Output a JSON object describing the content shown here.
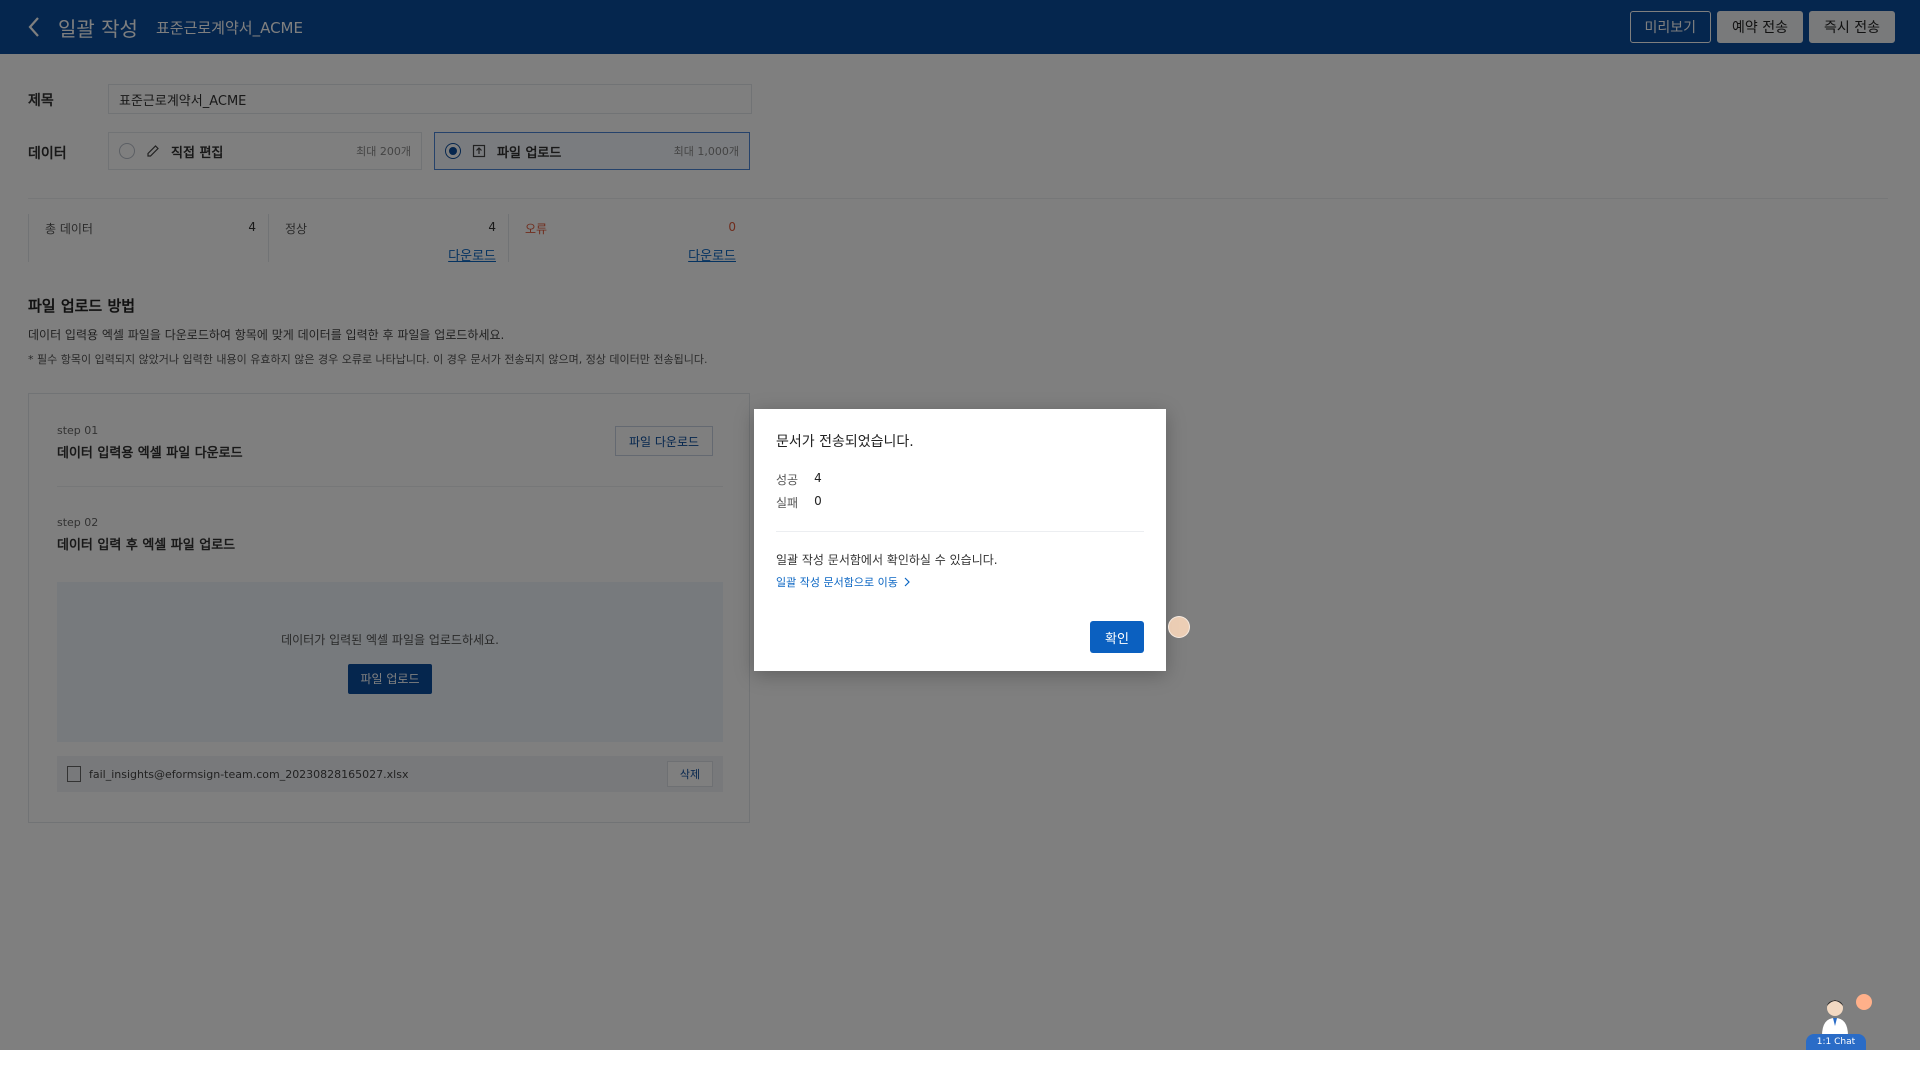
{
  "header": {
    "back_icon": "chevron-left-icon",
    "title": "일괄 작성",
    "doc_name": "표준근로계약서_ACME",
    "preview_label": "미리보기",
    "schedule_label": "예약 전송",
    "send_now_label": "즉시 전송"
  },
  "form": {
    "title_label": "제목",
    "title_value": "표준근로계약서_ACME",
    "data_label": "데이터",
    "option_direct": {
      "label": "직접 편집",
      "max": "최대 200개",
      "icon": "pencil-icon"
    },
    "option_upload": {
      "label": "파일 업로드",
      "max": "최대 1,000개",
      "icon": "upload-icon"
    }
  },
  "stats": {
    "total_label": "총 데이터",
    "total_value": "4",
    "normal_label": "정상",
    "normal_value": "4",
    "error_label": "오류",
    "error_value": "0",
    "download_label": "다운로드"
  },
  "method": {
    "title": "파일 업로드 방법",
    "desc": "데이터 입력용 엑셀 파일을 다운로드하여 항목에 맞게 데이터를 입력한 후 파일을 업로드하세요.",
    "note": "* 필수 항목이 입력되지 않았거나 입력한 내용이 유효하지 않은 경우 오류로 나타납니다. 이 경우 문서가 전송되지 않으며, 정상 데이터만 전송됩니다.",
    "step1_label": "step 01",
    "step1_title": "데이터 입력용 엑셀 파일 다운로드",
    "step1_button": "파일 다운로드",
    "step2_label": "step 02",
    "step2_title": "데이터 입력 후 엑셀 파일 업로드",
    "drop_text": "데이터가 입력된 엑셀 파일을 업로드하세요.",
    "upload_button": "파일 업로드",
    "file_name": "fail_insights@eformsign-team.com_20230828165027.xlsx",
    "delete_button": "삭제"
  },
  "modal": {
    "title": "문서가 전송되었습니다.",
    "success_label": "성공",
    "success_value": "4",
    "fail_label": "실패",
    "fail_value": "0",
    "message": "일괄 작성 문서함에서 확인하실 수 있습니다.",
    "link_label": "일괄 작성 문서함으로 이동",
    "ok_label": "확인"
  },
  "chat": {
    "label": "1:1 Chat"
  },
  "colors": {
    "header_bg": "#0b4c9c",
    "primary": "#0b60c0",
    "link": "#0b66c3",
    "error": "#e05a3a"
  }
}
